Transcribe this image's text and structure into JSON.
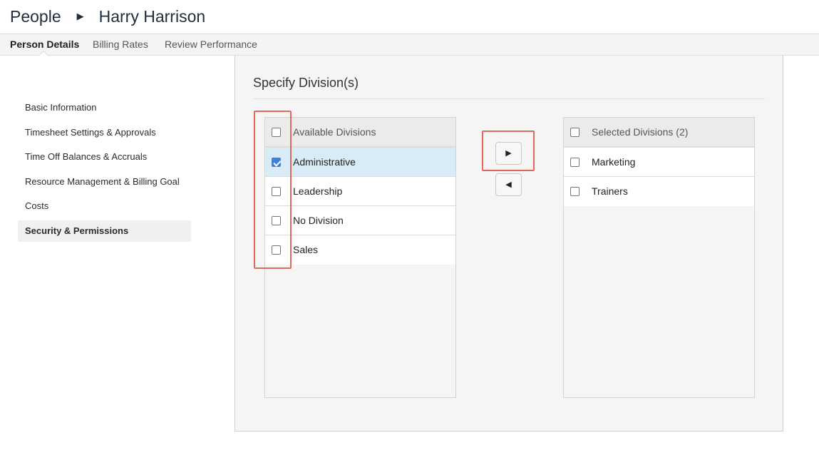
{
  "breadcrumb": {
    "root": "People",
    "separator_icon": "triangle-right-icon",
    "separator_glyph": "▶",
    "current": "Harry Harrison"
  },
  "tabs": [
    {
      "label": "Person Details",
      "active": true
    },
    {
      "label": "Billing Rates",
      "active": false
    },
    {
      "label": "Review Performance",
      "active": false
    }
  ],
  "sidebar": {
    "items": [
      {
        "label": "Basic Information",
        "active": false
      },
      {
        "label": "Timesheet Settings & Approvals",
        "active": false
      },
      {
        "label": "Time Off Balances & Accruals",
        "active": false
      },
      {
        "label": "Resource Management & Billing Goal",
        "active": false
      },
      {
        "label": "Costs",
        "active": false
      },
      {
        "label": "Security & Permissions",
        "active": true
      }
    ]
  },
  "panel": {
    "title": "Specify Division(s)"
  },
  "available": {
    "header": "Available Divisions",
    "items": [
      {
        "label": "Administrative",
        "checked": true
      },
      {
        "label": "Leadership",
        "checked": false
      },
      {
        "label": "No Division",
        "checked": false
      },
      {
        "label": "Sales",
        "checked": false
      }
    ]
  },
  "selected": {
    "header": "Selected Divisions (2)",
    "items": [
      {
        "label": "Marketing",
        "checked": false
      },
      {
        "label": "Trainers",
        "checked": false
      }
    ]
  },
  "buttons": {
    "move_right_glyph": "▶",
    "move_left_glyph": "◀"
  },
  "colors": {
    "highlight_border": "#e0685c",
    "selected_row": "#d9ebf5",
    "checkbox_checked": "#3b82e6"
  }
}
